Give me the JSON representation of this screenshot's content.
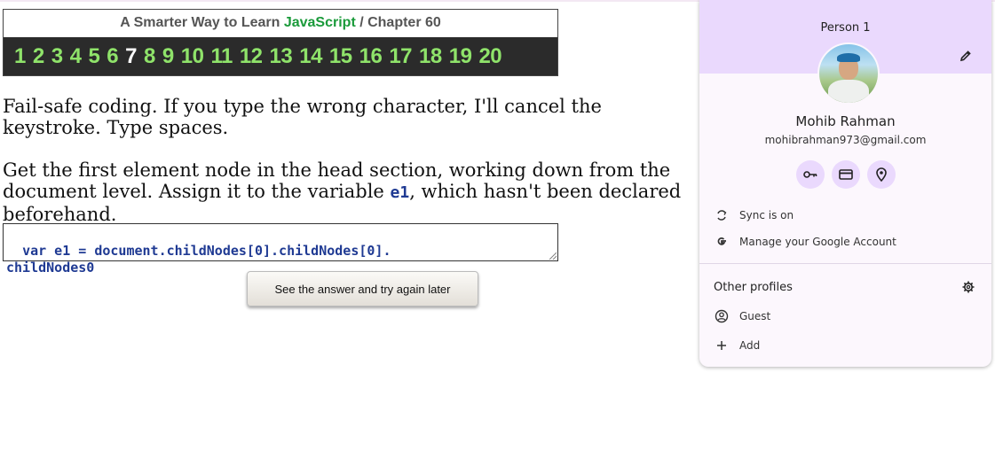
{
  "header": {
    "title_prefix": "A Smarter Way to Learn ",
    "title_js": "JavaScript",
    "title_suffix": " / Chapter 60",
    "chapters": [
      "1",
      "2",
      "3",
      "4",
      "5",
      "6",
      "7",
      "8",
      "9",
      "10",
      "11",
      "12",
      "13",
      "14",
      "15",
      "16",
      "17",
      "18",
      "19",
      "20"
    ],
    "current_chapter": "7"
  },
  "content": {
    "para1": "Fail-safe coding. If you type the wrong character, I'll cancel the keystroke. Type spaces.",
    "para2_before": "Get the first element node in the head section, working down from the document level. Assign it to the variable ",
    "para2_code": "e1",
    "para2_after": ", which hasn't been declared beforehand.",
    "answer_value": "var e1 = document.childNodes[0].childNodes[0].\nchildNodes0",
    "see_answer_label": "See the answer and try again later"
  },
  "profile_panel": {
    "profile_label": "Person 1",
    "account_name": "Mohib Rahman",
    "account_email": "mohibrahman973@gmail.com",
    "sync_label": "Sync is on",
    "manage_label": "Manage your Google Account",
    "other_profiles_label": "Other profiles",
    "guest_label": "Guest",
    "add_label": "Add",
    "icons": [
      "edit-icon",
      "key-icon",
      "card-icon",
      "location-icon",
      "sync-icon",
      "google-icon",
      "gear-icon",
      "person-icon",
      "plus-icon"
    ]
  },
  "colors": {
    "chapter_link": "#8fe36a",
    "current_chapter": "#ffffff",
    "javascript_green": "#1a9a3a",
    "code_blue": "#1f3a93",
    "panel_header": "#ead9fd"
  }
}
